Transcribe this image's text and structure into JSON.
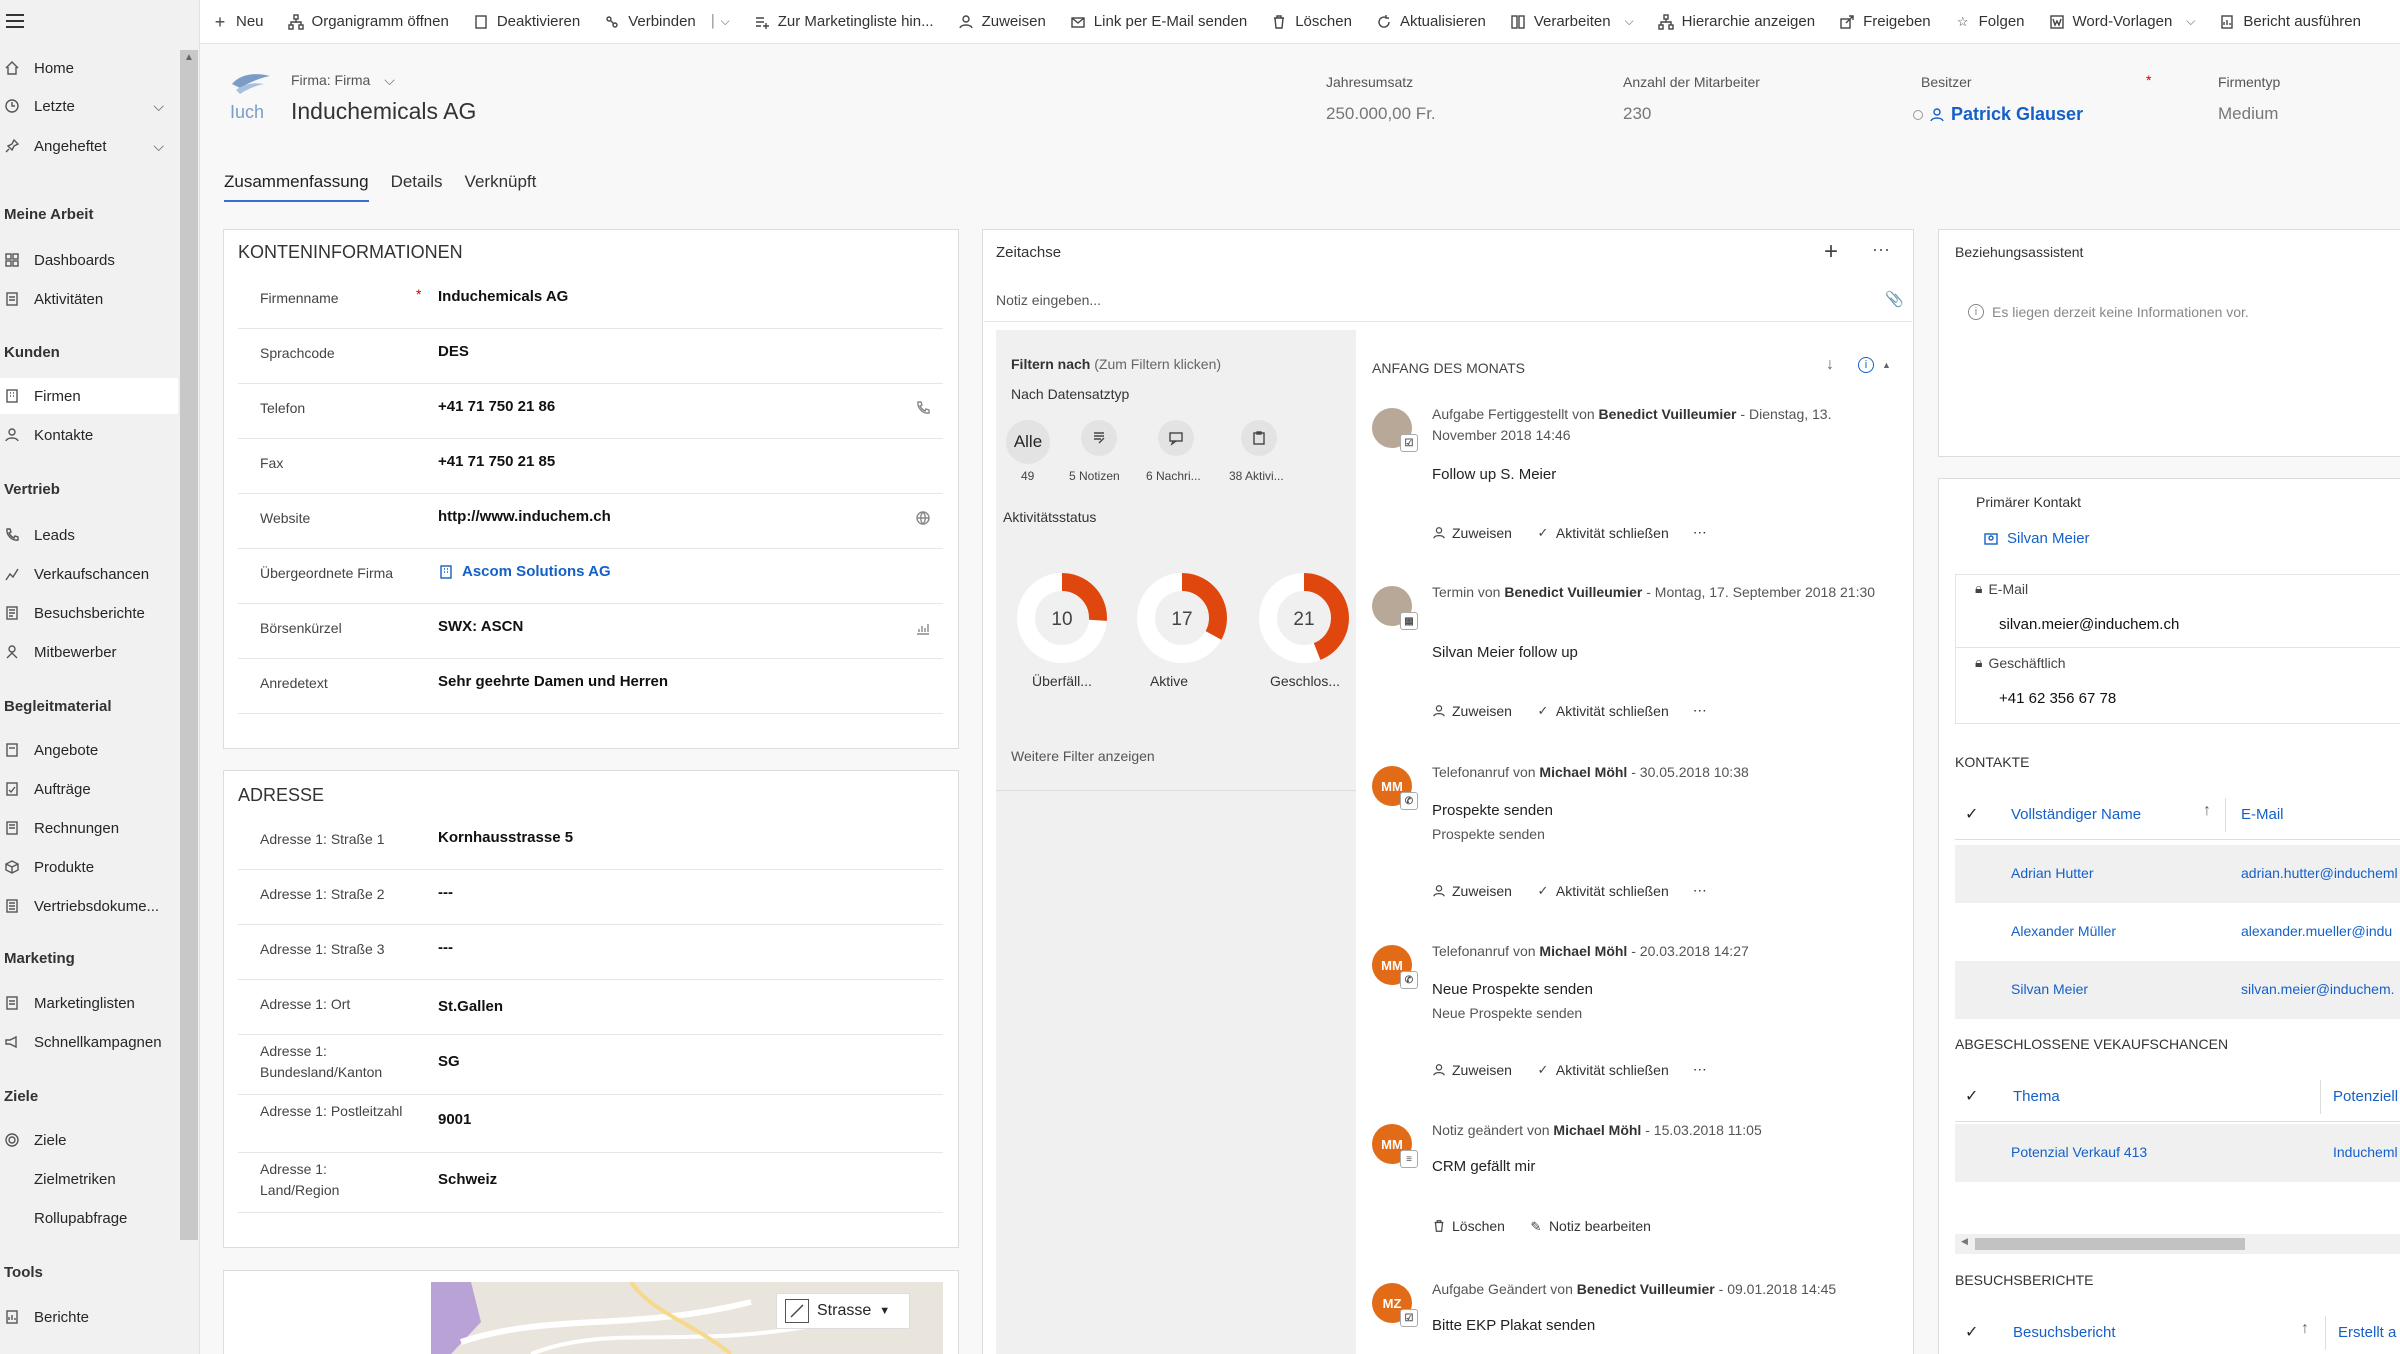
{
  "sidebar": {
    "items_top": [
      {
        "label": "Home",
        "icon": "home-icon"
      },
      {
        "label": "Letzte",
        "icon": "clock-icon"
      },
      {
        "label": "Angeheftet",
        "icon": "pin-icon"
      }
    ],
    "groups": [
      {
        "title": "Meine Arbeit",
        "items": [
          {
            "label": "Dashboards"
          },
          {
            "label": "Aktivitäten"
          }
        ]
      },
      {
        "title": "Kunden",
        "items": [
          {
            "label": "Firmen"
          },
          {
            "label": "Kontakte"
          }
        ]
      },
      {
        "title": "Vertrieb",
        "items": [
          {
            "label": "Leads"
          },
          {
            "label": "Verkaufschancen"
          },
          {
            "label": "Besuchsberichte"
          },
          {
            "label": "Mitbewerber"
          }
        ]
      },
      {
        "title": "Begleitmaterial",
        "items": [
          {
            "label": "Angebote"
          },
          {
            "label": "Aufträge"
          },
          {
            "label": "Rechnungen"
          },
          {
            "label": "Produkte"
          },
          {
            "label": "Vertriebsdokume..."
          }
        ]
      },
      {
        "title": "Marketing",
        "items": [
          {
            "label": "Marketinglisten"
          },
          {
            "label": "Schnellkampagnen"
          }
        ]
      },
      {
        "title": "Ziele",
        "items": [
          {
            "label": "Ziele"
          },
          {
            "label": "Zielmetriken"
          },
          {
            "label": "Rollupabfrage"
          }
        ]
      },
      {
        "title": "Tools",
        "items": [
          {
            "label": "Berichte"
          }
        ]
      }
    ]
  },
  "commands": [
    {
      "label": "Neu",
      "icon": "plus-icon"
    },
    {
      "label": "Organigramm öffnen",
      "icon": "orgchart-icon"
    },
    {
      "label": "Deaktivieren",
      "icon": "document-icon"
    },
    {
      "label": "Verbinden",
      "icon": "connect-icon"
    },
    {
      "label": "Zur Marketingliste hin...",
      "icon": "list-add-icon"
    },
    {
      "label": "Zuweisen",
      "icon": "person-icon"
    },
    {
      "label": "Link per E-Mail senden",
      "icon": "email-link-icon"
    },
    {
      "label": "Löschen",
      "icon": "trash-icon"
    },
    {
      "label": "Aktualisieren",
      "icon": "refresh-icon"
    },
    {
      "label": "Verarbeiten",
      "icon": "process-icon"
    },
    {
      "label": "Hierarchie anzeigen",
      "icon": "hierarchy-icon"
    },
    {
      "label": "Freigeben",
      "icon": "share-icon"
    },
    {
      "label": "Folgen",
      "icon": "star-icon"
    },
    {
      "label": "Word-Vorlagen",
      "icon": "word-icon"
    },
    {
      "label": "Bericht ausführen",
      "icon": "report-icon"
    }
  ],
  "header": {
    "entity_type": "Firma: Firma",
    "record_name": "Induchemicals AG",
    "fields": [
      {
        "label": "Jahresumsatz",
        "value": "250.000,00 Fr."
      },
      {
        "label": "Anzahl der Mitarbeiter",
        "value": "230"
      },
      {
        "label": "Besitzer",
        "value": "Patrick Glauser"
      },
      {
        "label": "Firmentyp",
        "value": "Medium"
      }
    ]
  },
  "tabs": [
    "Zusammenfassung",
    "Details",
    "Verknüpft"
  ],
  "konto": {
    "title": "KONTENINFORMATIONEN",
    "fields": [
      {
        "label": "Firmenname",
        "value": "Induchemicals AG"
      },
      {
        "label": "Sprachcode",
        "value": "DES"
      },
      {
        "label": "Telefon",
        "value": "+41 71 750 21 86"
      },
      {
        "label": "Fax",
        "value": "+41 71 750 21 85"
      },
      {
        "label": "Website",
        "value": "http://www.induchem.ch"
      },
      {
        "label": "Übergeordnete Firma",
        "value": "Ascom Solutions AG"
      },
      {
        "label": "Börsenkürzel",
        "value": "SWX: ASCN"
      },
      {
        "label": "Anredetext",
        "value": "Sehr geehrte Damen und Herren"
      }
    ]
  },
  "adresse": {
    "title": "ADRESSE",
    "fields": [
      {
        "label": "Adresse 1: Straße 1",
        "value": "Kornhausstrasse 5"
      },
      {
        "label": "Adresse 1: Straße 2",
        "value": "---"
      },
      {
        "label": "Adresse 1: Straße 3",
        "value": "---"
      },
      {
        "label": "Adresse 1: Ort",
        "value": "St.Gallen"
      },
      {
        "label": "Adresse 1: Bundesland/Kanton",
        "value": "SG"
      },
      {
        "label": "Adresse 1: Postleitzahl",
        "value": "9001"
      },
      {
        "label": "Adresse 1: Land/Region",
        "value": "Schweiz"
      }
    ]
  },
  "map": {
    "mode": "Strasse"
  },
  "timeline": {
    "title": "Zeitachse",
    "note_placeholder": "Notiz eingeben...",
    "filter_title": "Filtern nach",
    "filter_hint": "(Zum Filtern klicken)",
    "by_type": "Nach Datensatztyp",
    "types": [
      {
        "label": "Alle",
        "count": "49"
      },
      {
        "label": "",
        "count": "5 Notizen"
      },
      {
        "label": "",
        "count": "6 Nachri..."
      },
      {
        "label": "",
        "count": "38 Aktivi..."
      }
    ],
    "status_title": "Aktivitätsstatus",
    "status": [
      {
        "value": "10",
        "label": "Überfäll...",
        "fraction": 0.26
      },
      {
        "value": "17",
        "label": "Aktive",
        "fraction": 0.33
      },
      {
        "value": "21",
        "label": "Geschlos...",
        "fraction": 0.44
      }
    ],
    "more_filters": "Weitere Filter anzeigen",
    "section": "ANFANG DES MONATS",
    "entries": [
      {
        "head_pre": "Aufgabe Fertiggestellt von",
        "who": "Benedict Vuilleumier",
        "when": "Dienstag, 13. November 2018 14:46",
        "subject": "Follow up S. Meier",
        "detail": "",
        "actions": [
          "Zuweisen",
          "Aktivität schließen"
        ],
        "avatar": "photo"
      },
      {
        "head_pre": "Termin von",
        "who": "Benedict Vuilleumier",
        "when": "Montag, 17. September 2018 21:30",
        "subject": "Silvan Meier follow up",
        "detail": "",
        "actions": [
          "Zuweisen",
          "Aktivität schließen"
        ],
        "avatar": "photo"
      },
      {
        "head_pre": "Telefonanruf von",
        "who": "Michael Möhl",
        "when": "30.05.2018 10:38",
        "subject": "Prospekte senden",
        "detail": "Prospekte senden",
        "actions": [
          "Zuweisen",
          "Aktivität schließen"
        ],
        "avatar": "MM"
      },
      {
        "head_pre": "Telefonanruf von",
        "who": "Michael Möhl",
        "when": "20.03.2018 14:27",
        "subject": "Neue Prospekte senden",
        "detail": "Neue Prospekte senden",
        "actions": [
          "Zuweisen",
          "Aktivität schließen"
        ],
        "avatar": "MM"
      },
      {
        "head_pre": "Notiz geändert von",
        "who": "Michael Möhl",
        "when": "15.03.2018 11:05",
        "subject": "CRM gefällt mir",
        "detail": "",
        "actions": [
          "Löschen",
          "Notiz bearbeiten"
        ],
        "avatar": "MM"
      },
      {
        "head_pre": "Aufgabe Geändert von",
        "who": "Benedict Vuilleumier",
        "when": "09.01.2018 14:45",
        "subject": "Bitte EKP Plakat senden",
        "detail": "",
        "actions": [],
        "avatar": "MZ"
      }
    ]
  },
  "assistant": {
    "title": "Beziehungsassistent",
    "empty": "Es liegen derzeit keine Informationen vor."
  },
  "primary_contact": {
    "label": "Primärer Kontakt",
    "name": "Silvan Meier",
    "email_label": "E-Mail",
    "email": "silvan.meier@induchem.ch",
    "phone_label": "Geschäftlich",
    "phone": "+41 62 356 67 78"
  },
  "contacts": {
    "title": "KONTAKTE",
    "col1": "Vollständiger Name",
    "col2": "E-Mail",
    "rows": [
      {
        "name": "Adrian Hutter",
        "email": "adrian.hutter@inducheml"
      },
      {
        "name": "Alexander Müller",
        "email": "alexander.mueller@indu"
      },
      {
        "name": "Silvan Meier",
        "email": "silvan.meier@induchem."
      }
    ]
  },
  "opportunities": {
    "title": "ABGESCHLOSSENE VEKAUFSCHANCEN",
    "col1": "Thema",
    "col2": "Potenziell",
    "rows": [
      {
        "name": "Potenzial Verkauf 413",
        "account": "Inducheml"
      }
    ]
  },
  "visits": {
    "title": "BESUCHSBERICHTE",
    "col1": "Besuchsbericht",
    "col2": "Erstellt a"
  },
  "colors": {
    "accent": "#1560c8",
    "orange": "#e0470f",
    "avatar_orange": "#e26b17"
  }
}
